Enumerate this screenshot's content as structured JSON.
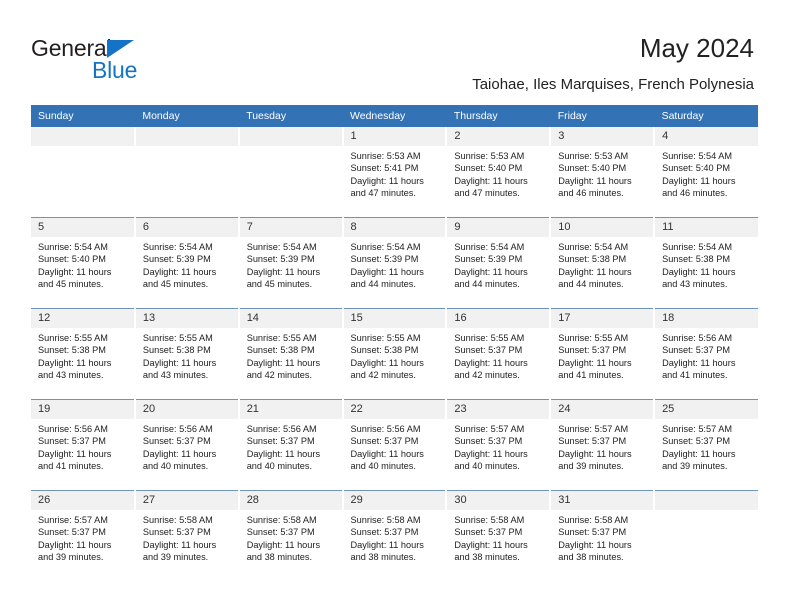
{
  "brand": {
    "name_part1": "General",
    "name_part2": "Blue",
    "accent_color": "#1473c6"
  },
  "header": {
    "title": "May 2024",
    "subtitle": "Taiohae, Iles Marquises, French Polynesia",
    "header_bg_color": "#3372b4"
  },
  "calendar": {
    "weekday_headers": [
      "Sunday",
      "Monday",
      "Tuesday",
      "Wednesday",
      "Thursday",
      "Friday",
      "Saturday"
    ],
    "weeks": [
      [
        {
          "day": "",
          "sunrise": "",
          "sunset": "",
          "daylight1": "",
          "daylight2": ""
        },
        {
          "day": "",
          "sunrise": "",
          "sunset": "",
          "daylight1": "",
          "daylight2": ""
        },
        {
          "day": "",
          "sunrise": "",
          "sunset": "",
          "daylight1": "",
          "daylight2": ""
        },
        {
          "day": "1",
          "sunrise": "Sunrise: 5:53 AM",
          "sunset": "Sunset: 5:41 PM",
          "daylight1": "Daylight: 11 hours",
          "daylight2": "and 47 minutes."
        },
        {
          "day": "2",
          "sunrise": "Sunrise: 5:53 AM",
          "sunset": "Sunset: 5:40 PM",
          "daylight1": "Daylight: 11 hours",
          "daylight2": "and 47 minutes."
        },
        {
          "day": "3",
          "sunrise": "Sunrise: 5:53 AM",
          "sunset": "Sunset: 5:40 PM",
          "daylight1": "Daylight: 11 hours",
          "daylight2": "and 46 minutes."
        },
        {
          "day": "4",
          "sunrise": "Sunrise: 5:54 AM",
          "sunset": "Sunset: 5:40 PM",
          "daylight1": "Daylight: 11 hours",
          "daylight2": "and 46 minutes."
        }
      ],
      [
        {
          "day": "5",
          "sunrise": "Sunrise: 5:54 AM",
          "sunset": "Sunset: 5:40 PM",
          "daylight1": "Daylight: 11 hours",
          "daylight2": "and 45 minutes."
        },
        {
          "day": "6",
          "sunrise": "Sunrise: 5:54 AM",
          "sunset": "Sunset: 5:39 PM",
          "daylight1": "Daylight: 11 hours",
          "daylight2": "and 45 minutes."
        },
        {
          "day": "7",
          "sunrise": "Sunrise: 5:54 AM",
          "sunset": "Sunset: 5:39 PM",
          "daylight1": "Daylight: 11 hours",
          "daylight2": "and 45 minutes."
        },
        {
          "day": "8",
          "sunrise": "Sunrise: 5:54 AM",
          "sunset": "Sunset: 5:39 PM",
          "daylight1": "Daylight: 11 hours",
          "daylight2": "and 44 minutes."
        },
        {
          "day": "9",
          "sunrise": "Sunrise: 5:54 AM",
          "sunset": "Sunset: 5:39 PM",
          "daylight1": "Daylight: 11 hours",
          "daylight2": "and 44 minutes."
        },
        {
          "day": "10",
          "sunrise": "Sunrise: 5:54 AM",
          "sunset": "Sunset: 5:38 PM",
          "daylight1": "Daylight: 11 hours",
          "daylight2": "and 44 minutes."
        },
        {
          "day": "11",
          "sunrise": "Sunrise: 5:54 AM",
          "sunset": "Sunset: 5:38 PM",
          "daylight1": "Daylight: 11 hours",
          "daylight2": "and 43 minutes."
        }
      ],
      [
        {
          "day": "12",
          "sunrise": "Sunrise: 5:55 AM",
          "sunset": "Sunset: 5:38 PM",
          "daylight1": "Daylight: 11 hours",
          "daylight2": "and 43 minutes."
        },
        {
          "day": "13",
          "sunrise": "Sunrise: 5:55 AM",
          "sunset": "Sunset: 5:38 PM",
          "daylight1": "Daylight: 11 hours",
          "daylight2": "and 43 minutes."
        },
        {
          "day": "14",
          "sunrise": "Sunrise: 5:55 AM",
          "sunset": "Sunset: 5:38 PM",
          "daylight1": "Daylight: 11 hours",
          "daylight2": "and 42 minutes."
        },
        {
          "day": "15",
          "sunrise": "Sunrise: 5:55 AM",
          "sunset": "Sunset: 5:38 PM",
          "daylight1": "Daylight: 11 hours",
          "daylight2": "and 42 minutes."
        },
        {
          "day": "16",
          "sunrise": "Sunrise: 5:55 AM",
          "sunset": "Sunset: 5:37 PM",
          "daylight1": "Daylight: 11 hours",
          "daylight2": "and 42 minutes."
        },
        {
          "day": "17",
          "sunrise": "Sunrise: 5:55 AM",
          "sunset": "Sunset: 5:37 PM",
          "daylight1": "Daylight: 11 hours",
          "daylight2": "and 41 minutes."
        },
        {
          "day": "18",
          "sunrise": "Sunrise: 5:56 AM",
          "sunset": "Sunset: 5:37 PM",
          "daylight1": "Daylight: 11 hours",
          "daylight2": "and 41 minutes."
        }
      ],
      [
        {
          "day": "19",
          "sunrise": "Sunrise: 5:56 AM",
          "sunset": "Sunset: 5:37 PM",
          "daylight1": "Daylight: 11 hours",
          "daylight2": "and 41 minutes."
        },
        {
          "day": "20",
          "sunrise": "Sunrise: 5:56 AM",
          "sunset": "Sunset: 5:37 PM",
          "daylight1": "Daylight: 11 hours",
          "daylight2": "and 40 minutes."
        },
        {
          "day": "21",
          "sunrise": "Sunrise: 5:56 AM",
          "sunset": "Sunset: 5:37 PM",
          "daylight1": "Daylight: 11 hours",
          "daylight2": "and 40 minutes."
        },
        {
          "day": "22",
          "sunrise": "Sunrise: 5:56 AM",
          "sunset": "Sunset: 5:37 PM",
          "daylight1": "Daylight: 11 hours",
          "daylight2": "and 40 minutes."
        },
        {
          "day": "23",
          "sunrise": "Sunrise: 5:57 AM",
          "sunset": "Sunset: 5:37 PM",
          "daylight1": "Daylight: 11 hours",
          "daylight2": "and 40 minutes."
        },
        {
          "day": "24",
          "sunrise": "Sunrise: 5:57 AM",
          "sunset": "Sunset: 5:37 PM",
          "daylight1": "Daylight: 11 hours",
          "daylight2": "and 39 minutes."
        },
        {
          "day": "25",
          "sunrise": "Sunrise: 5:57 AM",
          "sunset": "Sunset: 5:37 PM",
          "daylight1": "Daylight: 11 hours",
          "daylight2": "and 39 minutes."
        }
      ],
      [
        {
          "day": "26",
          "sunrise": "Sunrise: 5:57 AM",
          "sunset": "Sunset: 5:37 PM",
          "daylight1": "Daylight: 11 hours",
          "daylight2": "and 39 minutes."
        },
        {
          "day": "27",
          "sunrise": "Sunrise: 5:58 AM",
          "sunset": "Sunset: 5:37 PM",
          "daylight1": "Daylight: 11 hours",
          "daylight2": "and 39 minutes."
        },
        {
          "day": "28",
          "sunrise": "Sunrise: 5:58 AM",
          "sunset": "Sunset: 5:37 PM",
          "daylight1": "Daylight: 11 hours",
          "daylight2": "and 38 minutes."
        },
        {
          "day": "29",
          "sunrise": "Sunrise: 5:58 AM",
          "sunset": "Sunset: 5:37 PM",
          "daylight1": "Daylight: 11 hours",
          "daylight2": "and 38 minutes."
        },
        {
          "day": "30",
          "sunrise": "Sunrise: 5:58 AM",
          "sunset": "Sunset: 5:37 PM",
          "daylight1": "Daylight: 11 hours",
          "daylight2": "and 38 minutes."
        },
        {
          "day": "31",
          "sunrise": "Sunrise: 5:58 AM",
          "sunset": "Sunset: 5:37 PM",
          "daylight1": "Daylight: 11 hours",
          "daylight2": "and 38 minutes."
        },
        {
          "day": "",
          "sunrise": "",
          "sunset": "",
          "daylight1": "",
          "daylight2": ""
        }
      ]
    ]
  }
}
